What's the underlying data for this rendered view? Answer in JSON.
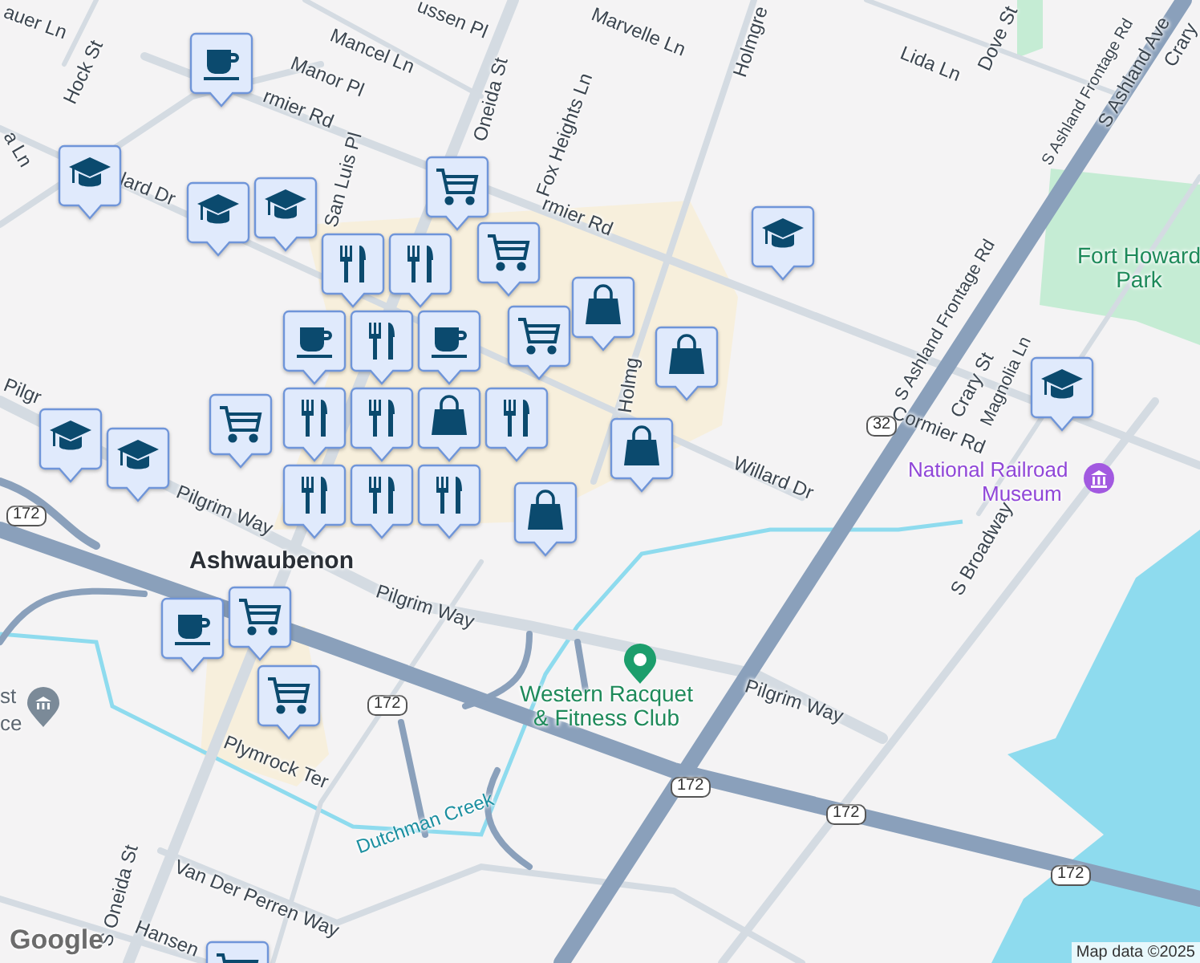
{
  "map": {
    "labels": [
      {
        "text": "auer Ln",
        "kind": "street"
      },
      {
        "text": "Hock St",
        "kind": "street"
      },
      {
        "text": "ussen Pl",
        "kind": "street"
      },
      {
        "text": "Mancel Ln",
        "kind": "street"
      },
      {
        "text": "Manor Pl",
        "kind": "street"
      },
      {
        "text": "rmier Rd",
        "kind": "street"
      },
      {
        "text": "Oneida St",
        "kind": "street"
      },
      {
        "text": "Fox Heights Ln",
        "kind": "street"
      },
      {
        "text": "Marvelle Ln",
        "kind": "street"
      },
      {
        "text": "Holmgre",
        "kind": "street"
      },
      {
        "text": "Lida Ln",
        "kind": "street"
      },
      {
        "text": "Dove St",
        "kind": "street"
      },
      {
        "text": "S Ashland Frontage Rd",
        "kind": "street"
      },
      {
        "text": "S Ashland Ave",
        "kind": "street"
      },
      {
        "text": "Crary",
        "kind": "street"
      },
      {
        "text": "a Ln",
        "kind": "street"
      },
      {
        "text": "lard Dr",
        "kind": "street"
      },
      {
        "text": "San Luis Pl",
        "kind": "street"
      },
      {
        "text": "rmier Rd",
        "kind": "street"
      },
      {
        "text": "Fort Howard Park",
        "kind": "park"
      },
      {
        "text": "S Ashland Frontage Rd",
        "kind": "street"
      },
      {
        "text": "Crary St",
        "kind": "street"
      },
      {
        "text": "Magnolia Ln",
        "kind": "street"
      },
      {
        "text": "Cormier Rd",
        "kind": "street"
      },
      {
        "text": "32",
        "kind": "shield"
      },
      {
        "text": "Holmg",
        "kind": "street"
      },
      {
        "text": "Willard Dr",
        "kind": "street"
      },
      {
        "text": "Pilgr",
        "kind": "street"
      },
      {
        "text": "Pilgrim Way",
        "kind": "street"
      },
      {
        "text": "National Railroad",
        "kind": "museum"
      },
      {
        "text": "Museum",
        "kind": "museum"
      },
      {
        "text": "172",
        "kind": "shield"
      },
      {
        "text": "Ashwaubenon",
        "kind": "place"
      },
      {
        "text": "Pilgrim Way",
        "kind": "street"
      },
      {
        "text": "S Broadway",
        "kind": "street"
      },
      {
        "text": "st",
        "kind": "poi"
      },
      {
        "text": "ce",
        "kind": "poi"
      },
      {
        "text": "172",
        "kind": "shield"
      },
      {
        "text": "Western Racquet & Fitness Club",
        "kind": "park"
      },
      {
        "text": "Pilgrim Way",
        "kind": "street"
      },
      {
        "text": "Plymrock Ter",
        "kind": "street"
      },
      {
        "text": "172",
        "kind": "shield"
      },
      {
        "text": "172",
        "kind": "shield"
      },
      {
        "text": "Dutchman Creek",
        "kind": "water"
      },
      {
        "text": "172",
        "kind": "shield"
      },
      {
        "text": "S Oneida St",
        "kind": "street"
      },
      {
        "text": "Van Der Perren Way",
        "kind": "street"
      },
      {
        "text": "Hansen",
        "kind": "street"
      }
    ],
    "markers": [
      {
        "kind": "coffee"
      },
      {
        "kind": "school"
      },
      {
        "kind": "school"
      },
      {
        "kind": "school"
      },
      {
        "kind": "cart"
      },
      {
        "kind": "cart"
      },
      {
        "kind": "food"
      },
      {
        "kind": "food"
      },
      {
        "kind": "school"
      },
      {
        "kind": "cart"
      },
      {
        "kind": "bag"
      },
      {
        "kind": "coffee"
      },
      {
        "kind": "food"
      },
      {
        "kind": "coffee"
      },
      {
        "kind": "bag"
      },
      {
        "kind": "school"
      },
      {
        "kind": "cart"
      },
      {
        "kind": "food"
      },
      {
        "kind": "food"
      },
      {
        "kind": "bag"
      },
      {
        "kind": "food"
      },
      {
        "kind": "school"
      },
      {
        "kind": "school"
      },
      {
        "kind": "bag"
      },
      {
        "kind": "food"
      },
      {
        "kind": "food"
      },
      {
        "kind": "food"
      },
      {
        "kind": "bag"
      },
      {
        "kind": "cart"
      },
      {
        "kind": "coffee"
      },
      {
        "kind": "cart"
      },
      {
        "kind": "cart"
      }
    ],
    "logo": "Google",
    "attribution": "Map data ©2025"
  }
}
